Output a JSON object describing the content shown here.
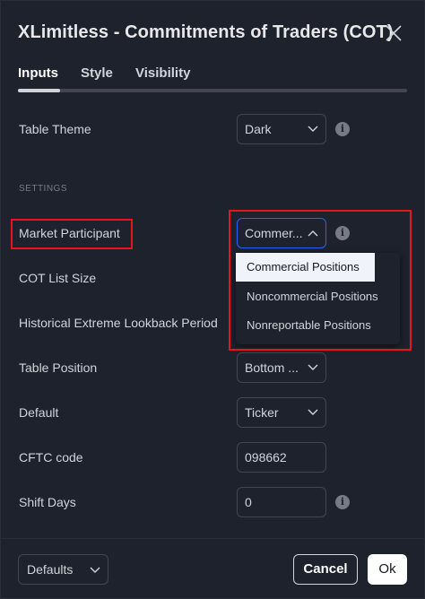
{
  "title": "XLimitless - Commitments of Traders (COT)",
  "tabs": [
    "Inputs",
    "Style",
    "Visibility"
  ],
  "active_tab": "Inputs",
  "section_settings": "SETTINGS",
  "fields": {
    "table_theme": {
      "label": "Table Theme",
      "value": "Dark"
    },
    "market_participant": {
      "label": "Market Participant",
      "value": "Commer..."
    },
    "cot_list_size": {
      "label": "COT List Size"
    },
    "historical_lookback": {
      "label": "Historical Extreme Lookback Period"
    },
    "table_position": {
      "label": "Table Position",
      "value": "Bottom ..."
    },
    "default": {
      "label": "Default",
      "value": "Ticker"
    },
    "cftc_code": {
      "label": "CFTC code",
      "value": "098662"
    },
    "shift_days": {
      "label": "Shift Days",
      "value": "0"
    }
  },
  "dropdown_options": [
    "Commercial Positions",
    "Noncommercial Positions",
    "Nonreportable Positions"
  ],
  "selected_option": "Commercial Positions",
  "footer": {
    "defaults": "Defaults",
    "cancel": "Cancel",
    "ok": "Ok"
  },
  "icons": {
    "close": "close-icon",
    "info": "info-icon",
    "chevron_down": "chevron-down-icon",
    "chevron_up": "chevron-up-icon"
  },
  "colors": {
    "background": "#1e222d",
    "focus_border": "#2962ff",
    "highlight": "#e8141b",
    "selected_option_bg": "#f0f3fa"
  }
}
